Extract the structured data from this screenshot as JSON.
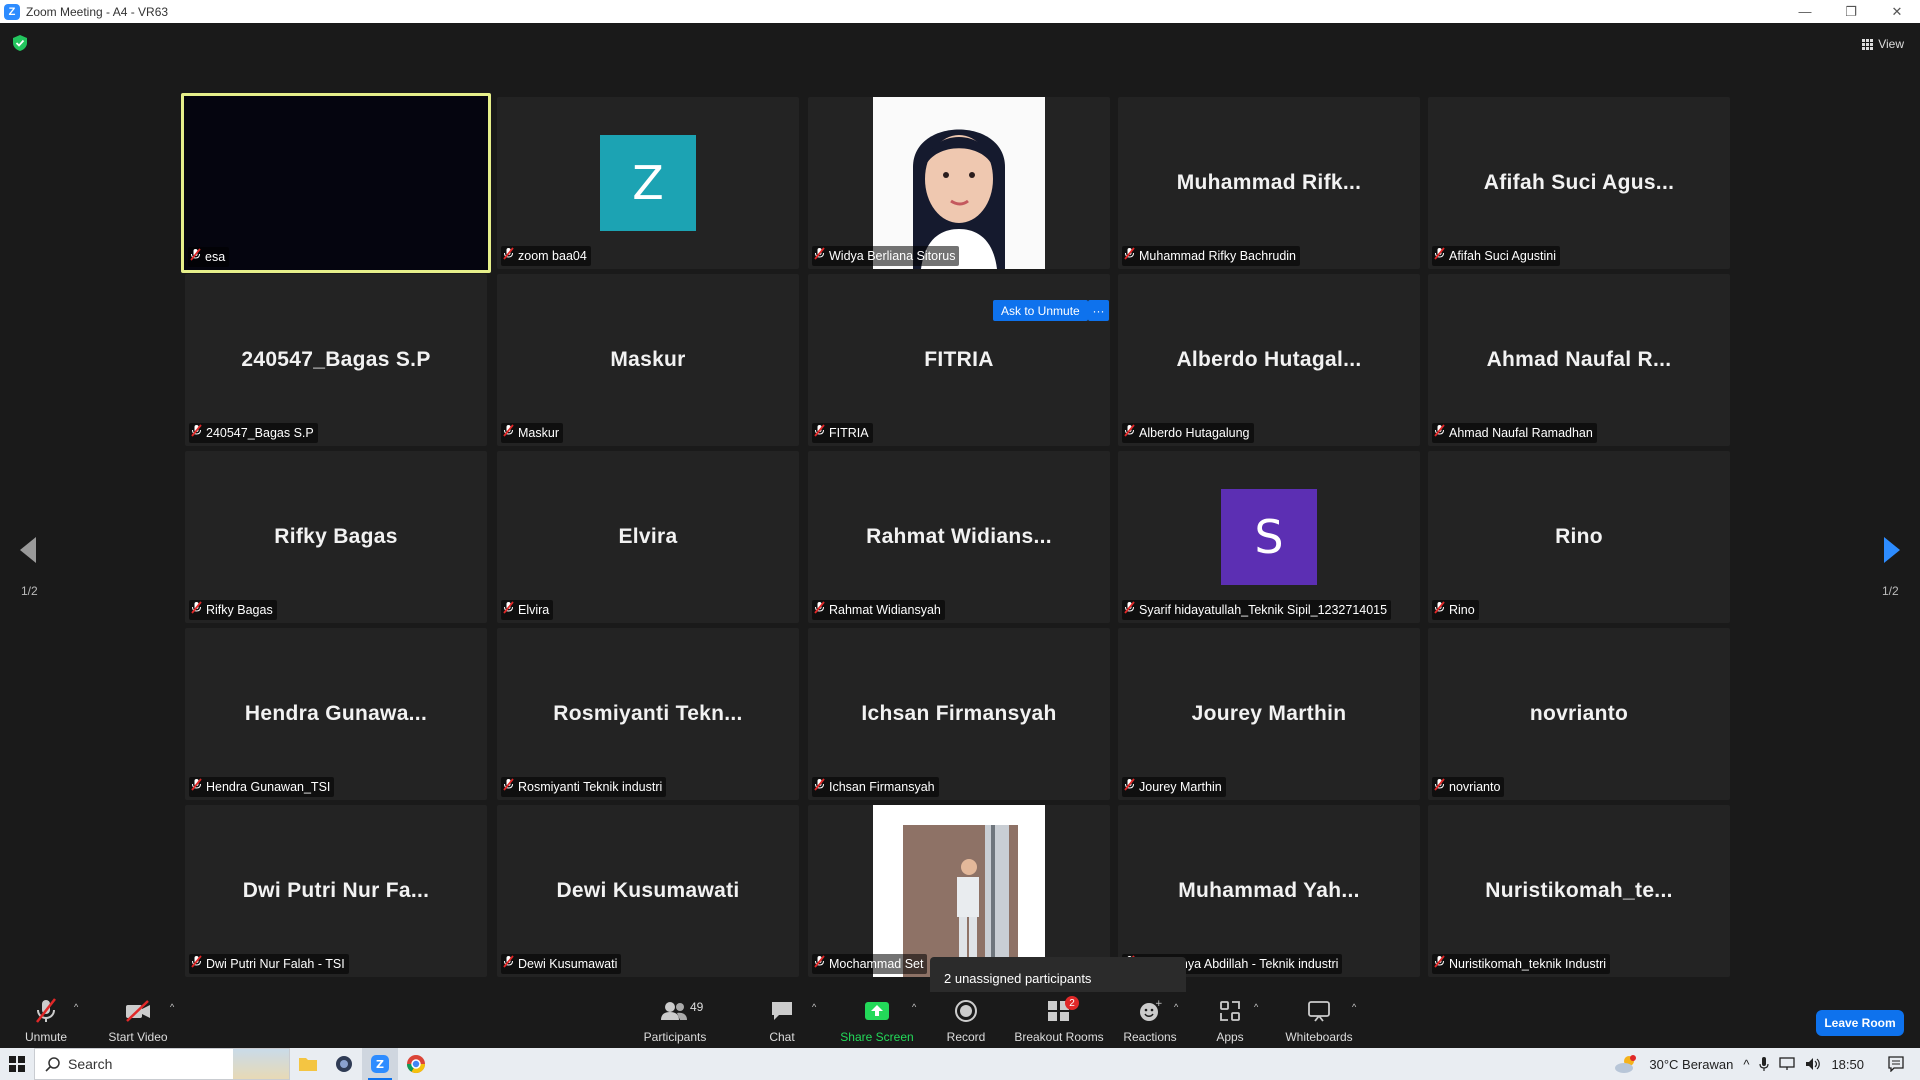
{
  "window": {
    "title": "Zoom Meeting - A4 - VR63",
    "logo_letter": "Z"
  },
  "view_label": "View",
  "page_indicator": "1/2",
  "ask_to_unmute": "Ask to Unmute",
  "more_label": "···",
  "tiles": [
    {
      "big": "",
      "label": "esa",
      "active": true
    },
    {
      "big": "",
      "label": "zoom baa04",
      "avatar": "Z",
      "avatar_color": "#1ca3b3"
    },
    {
      "big": "",
      "label": "Widya Berliana Sitorus",
      "photo": "portrait"
    },
    {
      "big": "Muhammad  Rifk...",
      "label": "Muhammad Rifky Bachrudin"
    },
    {
      "big": "Afifah  Suci  Agus...",
      "label": "Afifah Suci Agustini"
    },
    {
      "big": "240547_Bagas S.P",
      "label": "240547_Bagas S.P"
    },
    {
      "big": "Maskur",
      "label": "Maskur"
    },
    {
      "big": "FITRIA",
      "label": "FITRIA"
    },
    {
      "big": "Alberdo  Hutagal...",
      "label": "Alberdo Hutagalung"
    },
    {
      "big": "Ahmad  Naufal  R...",
      "label": "Ahmad Naufal Ramadhan"
    },
    {
      "big": "Rifky Bagas",
      "label": "Rifky Bagas"
    },
    {
      "big": "Elvira",
      "label": "Elvira"
    },
    {
      "big": "Rahmat  Widians...",
      "label": "Rahmat Widiansyah"
    },
    {
      "big": "",
      "label": "Syarif hidayatullah_Teknik Sipil_1232714015",
      "avatar": "S",
      "avatar_color": "#5c2fb3"
    },
    {
      "big": "Rino",
      "label": "Rino"
    },
    {
      "big": "Hendra  Gunawa...",
      "label": "Hendra Gunawan_TSI"
    },
    {
      "big": "Rosmiyanti  Tekn...",
      "label": "Rosmiyanti Teknik industri"
    },
    {
      "big": "Ichsan Firmansyah",
      "label": "Ichsan Firmansyah"
    },
    {
      "big": "Jourey Marthin",
      "label": "Jourey Marthin"
    },
    {
      "big": "novrianto",
      "label": "novrianto"
    },
    {
      "big": "Dwi  Putri  Nur  Fa...",
      "label": "Dwi Putri Nur Falah - TSI"
    },
    {
      "big": "Dewi Kusumawati",
      "label": "Dewi Kusumawati"
    },
    {
      "big": "",
      "label": "Mochammad Set",
      "photo": "room"
    },
    {
      "big": "Muhammad  Yah...",
      "label": "mad Yahya Abdillah - Teknik industri"
    },
    {
      "big": "Nuristikomah_te...",
      "label": "Nuristikomah_teknik Industri"
    }
  ],
  "tooltip": "2 unassigned participants",
  "toolbar": {
    "unmute": "Unmute",
    "start_video": "Start Video",
    "participants": "Participants",
    "participants_count": "49",
    "chat": "Chat",
    "share_screen": "Share Screen",
    "record": "Record",
    "breakout_rooms": "Breakout Rooms",
    "breakout_badge": "2",
    "reactions": "Reactions",
    "apps": "Apps",
    "whiteboards": "Whiteboards",
    "leave_room": "Leave Room"
  },
  "taskbar": {
    "search": "Search",
    "weather": "30°C  Berawan",
    "time": "18:50"
  },
  "colors": {
    "accent": "#0e72ed",
    "active_border": "#e6ef8a",
    "share_green": "#23d959"
  }
}
